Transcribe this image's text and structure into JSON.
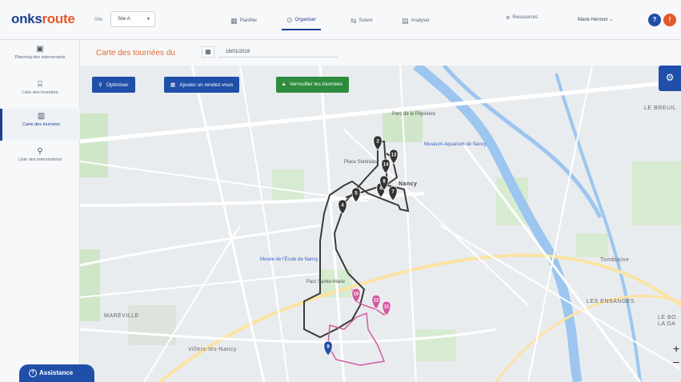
{
  "app": {
    "logo_main": "onks",
    "logo_accent": "route"
  },
  "header": {
    "site_label": "Site",
    "site_value": "Site A",
    "nav": [
      {
        "label": "Planifier",
        "icon": "calendar-icon"
      },
      {
        "label": "Organiser",
        "icon": "route-icon"
      },
      {
        "label": "Suivre",
        "icon": "signpost-icon"
      },
      {
        "label": "Analyser",
        "icon": "chart-icon"
      }
    ],
    "ressources": "Ressources",
    "user": "Marie Hennon",
    "help": "?",
    "notif": "!"
  },
  "sidebar": {
    "items": [
      {
        "label": "Planning des intervenants"
      },
      {
        "label": "Liste des tournées"
      },
      {
        "label": "Carte des tournées"
      },
      {
        "label": "Liste des interventions"
      }
    ],
    "assistance": "Assistance"
  },
  "map_header": {
    "title": "Carte des tournées du",
    "date": "16/01/2019"
  },
  "map": {
    "buttons": {
      "optimiser": "Optimiser",
      "rdv": "Ajouter un rendez-vous",
      "lock": "Verrouiller les tournées"
    },
    "labels": {
      "park": "Parc de la Pépinière",
      "museum": "Muséum-Aquarium de Nancy",
      "place": "Place Stanislas",
      "city": "Nancy",
      "ecole": "Musée de l'École de Nancy",
      "parc_ste_marie": "Parc Sainte-Marie",
      "mareville": "MARÉVILLE",
      "villers": "Villers-lès-Nancy",
      "tomblaine": "Tomblaine",
      "ensanges": "LES ENSANGES",
      "breuil": "LE BREUIL",
      "bois": "LE BO LA DA"
    },
    "markers_dark": [
      "2",
      "4",
      "5",
      "6",
      "7",
      "8",
      "13",
      "14"
    ],
    "markers_pink": [
      "10",
      "11",
      "12"
    ],
    "marker_blue": "9",
    "zoom_in": "+",
    "zoom_out": "–"
  },
  "colors": {
    "brand": "#1d3f8f",
    "accent": "#e25a2c",
    "blue_btn": "#1f4fa8",
    "green_btn": "#2e8b3e",
    "route_dark": "#333",
    "route_pink": "#d25aa0"
  }
}
